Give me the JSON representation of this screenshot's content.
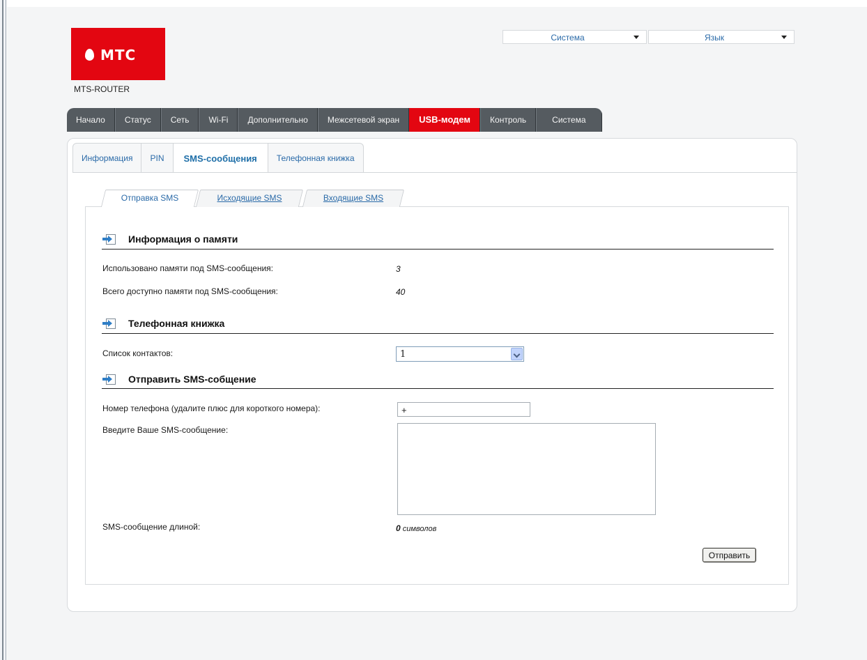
{
  "header": {
    "brand": "МТС",
    "router_name": "MTS-ROUTER",
    "system_select": "Система",
    "language_select": "Язык"
  },
  "mainnav": {
    "items": [
      "Начало",
      "Статус",
      "Сеть",
      "Wi-Fi",
      "Дополнительно",
      "Межсетевой экран",
      "USB-модем",
      "Контроль",
      "Система"
    ],
    "active_index": 6
  },
  "subtabs": {
    "items": [
      "Информация",
      "PIN",
      "SMS-сообщения",
      "Телефонная книжка"
    ],
    "active_index": 2
  },
  "smstabs": {
    "items": [
      "Отправка SMS",
      "Исходящие SMS",
      "Входящие SMS"
    ],
    "active_index": 0
  },
  "memory": {
    "title": "Информация о памяти",
    "used_label": "Использовано памяти под SMS-сообщения:",
    "used_value": "3",
    "total_label": "Всего доступно памяти под SMS-сообщения:",
    "total_value": "40"
  },
  "phonebook": {
    "title": "Телефонная книжка",
    "contacts_label": "Список контактов:",
    "contacts_value": "1"
  },
  "send": {
    "title": "Отправить SMS-собщение",
    "phone_label": "Номер телефона (удалите плюс для короткого номера):",
    "phone_value": "+",
    "message_label": "Введите Ваше SMS-сообщение:",
    "message_value": "",
    "length_label": "SMS-сообщение длиной:",
    "length_count": "0",
    "length_unit": " символов",
    "send_button": "Отправить"
  },
  "colors": {
    "brand_red": "#e30611",
    "nav_dark": "#555b60",
    "link_blue": "#2a6aa8"
  }
}
